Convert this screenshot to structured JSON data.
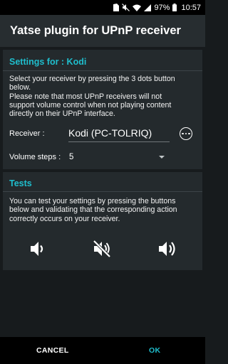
{
  "status_bar": {
    "battery": "97%",
    "time": "10:57",
    "icons": [
      "sim-card-icon",
      "mute-icon",
      "wifi-icon",
      "signal-icon",
      "battery-icon"
    ]
  },
  "header": {
    "title": "Yatse plugin for UPnP receiver"
  },
  "settings": {
    "title": "Settings for : Kodi",
    "description_lines": [
      "Select your receiver by pressing the 3 dots button",
      "below.",
      "Please note that most UPnP receivers will not",
      "support volume control when not playing content",
      "directly on their UPnP interface."
    ],
    "receiver_label": "Receiver :",
    "receiver_value": "Kodi (PC-TOLRIQ)",
    "volume_steps_label": "Volume steps :",
    "volume_steps_value": "5"
  },
  "tests": {
    "title": "Tests",
    "description_lines": [
      "You can test your settings by pressing the buttons",
      "below and validating that the corresponding action",
      "correctly occurs on your receiver."
    ],
    "buttons": [
      "volume-down-icon",
      "volume-mute-icon",
      "volume-up-icon"
    ]
  },
  "footer": {
    "cancel_label": "CANCEL",
    "ok_label": "OK"
  },
  "colors": {
    "accent": "#1fbecd",
    "background": "#171b1d",
    "header": "#272d30",
    "section": "#242a2d"
  }
}
